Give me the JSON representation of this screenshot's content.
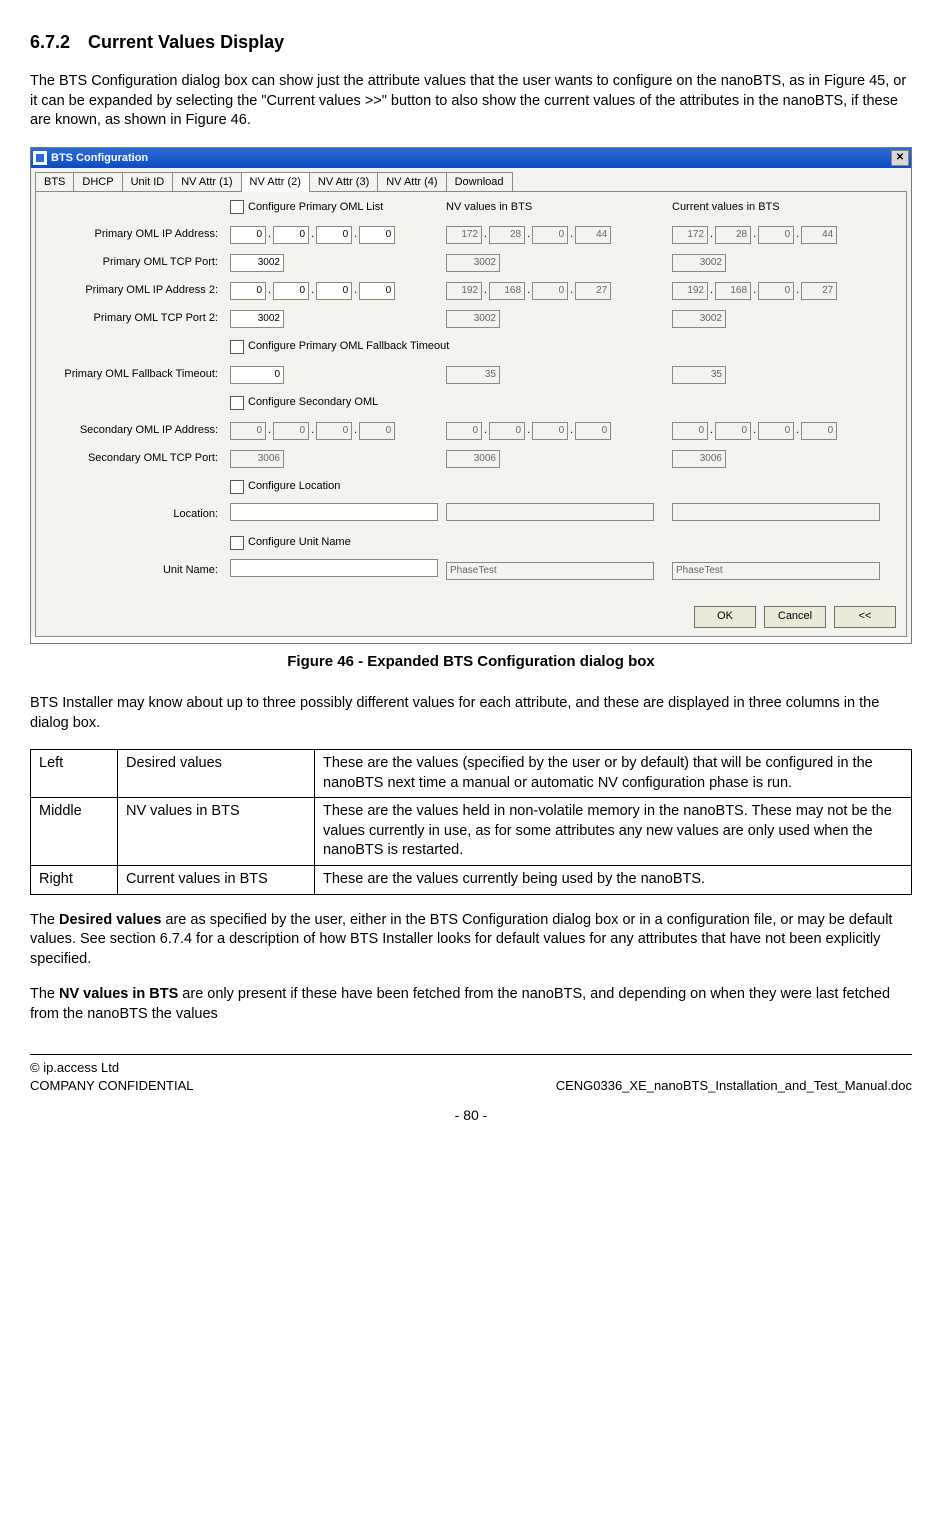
{
  "section": {
    "number": "6.7.2",
    "title": "Current Values Display"
  },
  "para1": "The BTS Configuration dialog box can show just the attribute values that the user wants to configure on the nanoBTS, as in Figure 45, or it can be expanded by selecting the \"Current values >>\" button to also show the current values of the attributes in the nanoBTS, if these are known, as shown in Figure 46.",
  "dialog": {
    "title": "BTS Configuration",
    "tabs": [
      "BTS",
      "DHCP",
      "Unit ID",
      "NV Attr (1)",
      "NV Attr (2)",
      "NV Attr (3)",
      "NV Attr (4)",
      "Download"
    ],
    "active_tab_index": 4,
    "col_headers": {
      "nv": "NV values in BTS",
      "cur": "Current values in BTS"
    },
    "checks": {
      "primary_oml": "Configure Primary OML List",
      "fallback": "Configure Primary OML Fallback Timeout",
      "secondary": "Configure Secondary OML",
      "location": "Configure Location",
      "unitname": "Configure Unit Name"
    },
    "rows": {
      "primary_ip": {
        "label": "Primary OML IP Address:",
        "left": [
          "0",
          "0",
          "0",
          "0"
        ],
        "mid": [
          "172",
          "28",
          "0",
          "44"
        ],
        "right": [
          "172",
          "28",
          "0",
          "44"
        ]
      },
      "primary_port": {
        "label": "Primary OML TCP Port:",
        "left": "3002",
        "mid": "3002",
        "right": "3002"
      },
      "primary_ip2": {
        "label": "Primary OML IP Address 2:",
        "left": [
          "0",
          "0",
          "0",
          "0"
        ],
        "mid": [
          "192",
          "168",
          "0",
          "27"
        ],
        "right": [
          "192",
          "168",
          "0",
          "27"
        ]
      },
      "primary_port2": {
        "label": "Primary OML TCP Port 2:",
        "left": "3002",
        "mid": "3002",
        "right": "3002"
      },
      "fallback_to": {
        "label": "Primary OML Fallback Timeout:",
        "left": "0",
        "mid": "35",
        "right": "35"
      },
      "sec_ip": {
        "label": "Secondary OML IP Address:",
        "left": [
          "0",
          "0",
          "0",
          "0"
        ],
        "mid": [
          "0",
          "0",
          "0",
          "0"
        ],
        "right": [
          "0",
          "0",
          "0",
          "0"
        ]
      },
      "sec_port": {
        "label": "Secondary OML TCP Port:",
        "left": "3006",
        "mid": "3006",
        "right": "3006"
      },
      "location": {
        "label": "Location:",
        "left": "",
        "mid": "",
        "right": ""
      },
      "unitname": {
        "label": "Unit Name:",
        "left": "",
        "mid": "PhaseTest",
        "right": "PhaseTest"
      }
    },
    "buttons": {
      "ok": "OK",
      "cancel": "Cancel",
      "collapse": "<<"
    }
  },
  "fig_caption": "Figure 46 - Expanded BTS Configuration dialog box",
  "para2": "BTS Installer may know about up to three possibly different values for each attribute, and these are displayed in three columns in the dialog box.",
  "table": {
    "rows": [
      {
        "c1": "Left",
        "c2": "Desired values",
        "c3": "These are the values (specified by the user or by default) that will be configured in the nanoBTS next time a manual or automatic NV configuration phase is run."
      },
      {
        "c1": "Middle",
        "c2": "NV values in BTS",
        "c3": "These are the values held in non-volatile memory in the nanoBTS. These may not be the values currently in use, as for some attributes any new values are only used when the nanoBTS is restarted."
      },
      {
        "c1": "Right",
        "c2": "Current values in BTS",
        "c3": "These are the values currently being used by the nanoBTS."
      }
    ]
  },
  "para3_pre": "The ",
  "para3_bold": "Desired values",
  "para3_post": " are as specified by the user, either in the BTS Configuration dialog box or in a configuration file, or may be default values. See section 6.7.4 for a description of how BTS Installer looks for default values for any attributes that have not been explicitly specified.",
  "para4_pre": "The ",
  "para4_bold": "NV values in BTS",
  "para4_post": " are only present if these have been fetched from the nanoBTS, and depending on when they were last fetched from the nanoBTS the values",
  "footer": {
    "copyright": "© ip.access Ltd",
    "confidential": "COMPANY CONFIDENTIAL",
    "docname": "CENG0336_XE_nanoBTS_Installation_and_Test_Manual.doc",
    "page": "- 80 -"
  }
}
